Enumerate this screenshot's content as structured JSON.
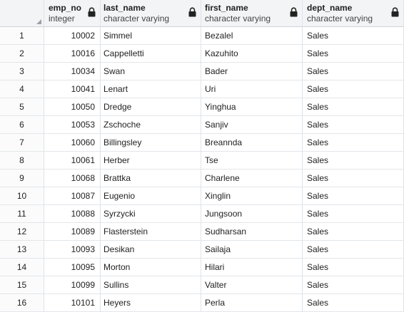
{
  "columns": [
    {
      "name": "emp_no",
      "type": "integer"
    },
    {
      "name": "last_name",
      "type": "character varying"
    },
    {
      "name": "first_name",
      "type": "character varying"
    },
    {
      "name": "dept_name",
      "type": "character varying"
    }
  ],
  "rows": [
    {
      "n": "1",
      "emp_no": "10002",
      "last_name": "Simmel",
      "first_name": "Bezalel",
      "dept_name": "Sales"
    },
    {
      "n": "2",
      "emp_no": "10016",
      "last_name": "Cappelletti",
      "first_name": "Kazuhito",
      "dept_name": "Sales"
    },
    {
      "n": "3",
      "emp_no": "10034",
      "last_name": "Swan",
      "first_name": "Bader",
      "dept_name": "Sales"
    },
    {
      "n": "4",
      "emp_no": "10041",
      "last_name": "Lenart",
      "first_name": "Uri",
      "dept_name": "Sales"
    },
    {
      "n": "5",
      "emp_no": "10050",
      "last_name": "Dredge",
      "first_name": "Yinghua",
      "dept_name": "Sales"
    },
    {
      "n": "6",
      "emp_no": "10053",
      "last_name": "Zschoche",
      "first_name": "Sanjiv",
      "dept_name": "Sales"
    },
    {
      "n": "7",
      "emp_no": "10060",
      "last_name": "Billingsley",
      "first_name": "Breannda",
      "dept_name": "Sales"
    },
    {
      "n": "8",
      "emp_no": "10061",
      "last_name": "Herber",
      "first_name": "Tse",
      "dept_name": "Sales"
    },
    {
      "n": "9",
      "emp_no": "10068",
      "last_name": "Brattka",
      "first_name": "Charlene",
      "dept_name": "Sales"
    },
    {
      "n": "10",
      "emp_no": "10087",
      "last_name": "Eugenio",
      "first_name": "Xinglin",
      "dept_name": "Sales"
    },
    {
      "n": "11",
      "emp_no": "10088",
      "last_name": "Syrzycki",
      "first_name": "Jungsoon",
      "dept_name": "Sales"
    },
    {
      "n": "12",
      "emp_no": "10089",
      "last_name": "Flasterstein",
      "first_name": "Sudharsan",
      "dept_name": "Sales"
    },
    {
      "n": "13",
      "emp_no": "10093",
      "last_name": "Desikan",
      "first_name": "Sailaja",
      "dept_name": "Sales"
    },
    {
      "n": "14",
      "emp_no": "10095",
      "last_name": "Morton",
      "first_name": "Hilari",
      "dept_name": "Sales"
    },
    {
      "n": "15",
      "emp_no": "10099",
      "last_name": "Sullins",
      "first_name": "Valter",
      "dept_name": "Sales"
    },
    {
      "n": "16",
      "emp_no": "10101",
      "last_name": "Heyers",
      "first_name": "Perla",
      "dept_name": "Sales"
    }
  ],
  "icons": {
    "column_lock": "lock-icon",
    "select_all": "select-all-corner-icon"
  }
}
